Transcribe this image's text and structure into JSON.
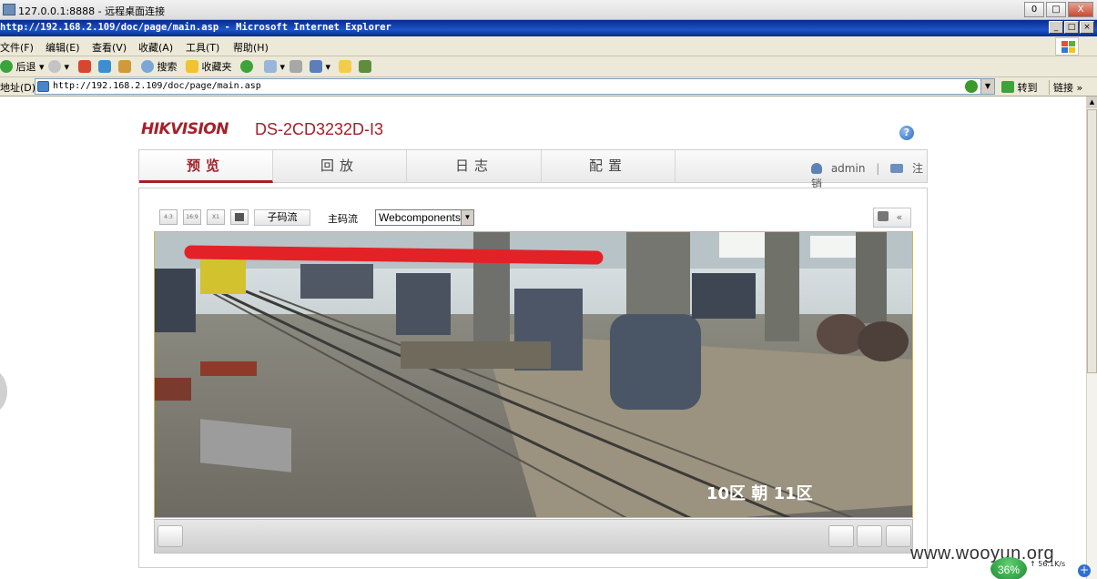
{
  "remote_desktop": {
    "title": "127.0.0.1:8888 - 远程桌面连接",
    "minimize": "0",
    "restore": "□",
    "close": "X"
  },
  "ie": {
    "title": "http://192.168.2.109/doc/page/main.asp - Microsoft Internet Explorer",
    "menu": [
      "文件(F)",
      "编辑(E)",
      "查看(V)",
      "收藏(A)",
      "工具(T)",
      "帮助(H)"
    ],
    "toolbar": {
      "back": "后退",
      "search": "搜索",
      "favorites": "收藏夹"
    },
    "address": {
      "label": "地址(D)",
      "url": "http://192.168.2.109/doc/page/main.asp",
      "go": "转到",
      "links": "链接"
    }
  },
  "page": {
    "brand": "HIKVISION",
    "model": "DS-2CD3232D-I3",
    "help": "?",
    "nav": {
      "tabs": [
        "预览",
        "回放",
        "日志",
        "配置"
      ],
      "active": "预览",
      "user": "admin",
      "separator": "|",
      "logout": "注销"
    },
    "controls": {
      "ratio_43": "4:3",
      "ratio_169": "16:9",
      "ratio_x1": "X1",
      "sub_stream": "子码流",
      "main_stream": "主码流",
      "plugin": "Webcomponents",
      "collapse": "«"
    },
    "video": {
      "osd_text": "10区 朝 11区",
      "redaction_color": "#e32228"
    }
  },
  "overlay": {
    "watermark": "www.wooyun.org",
    "cpu_percent": "36%",
    "net_speed": "56.1K/s"
  }
}
